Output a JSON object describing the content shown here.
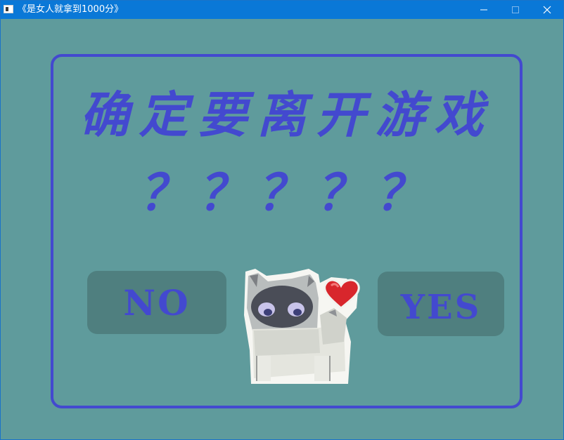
{
  "window": {
    "title": "《是女人就拿到1000分》"
  },
  "dialog": {
    "headline": "确定要离开游戏",
    "question": "？？？？？",
    "no_label": "NO",
    "yes_label": "YES"
  },
  "icons": {
    "app": "app-icon",
    "minimize": "minimize-icon",
    "maximize": "maximize-icon",
    "close": "close-icon",
    "mascot": "cat-with-heart-icon"
  },
  "colors": {
    "background": "#5f9b9c",
    "accent": "#4349cf",
    "button": "#4f7f7f",
    "titlebar": "#0a78d7",
    "heart": "#d8262c"
  }
}
